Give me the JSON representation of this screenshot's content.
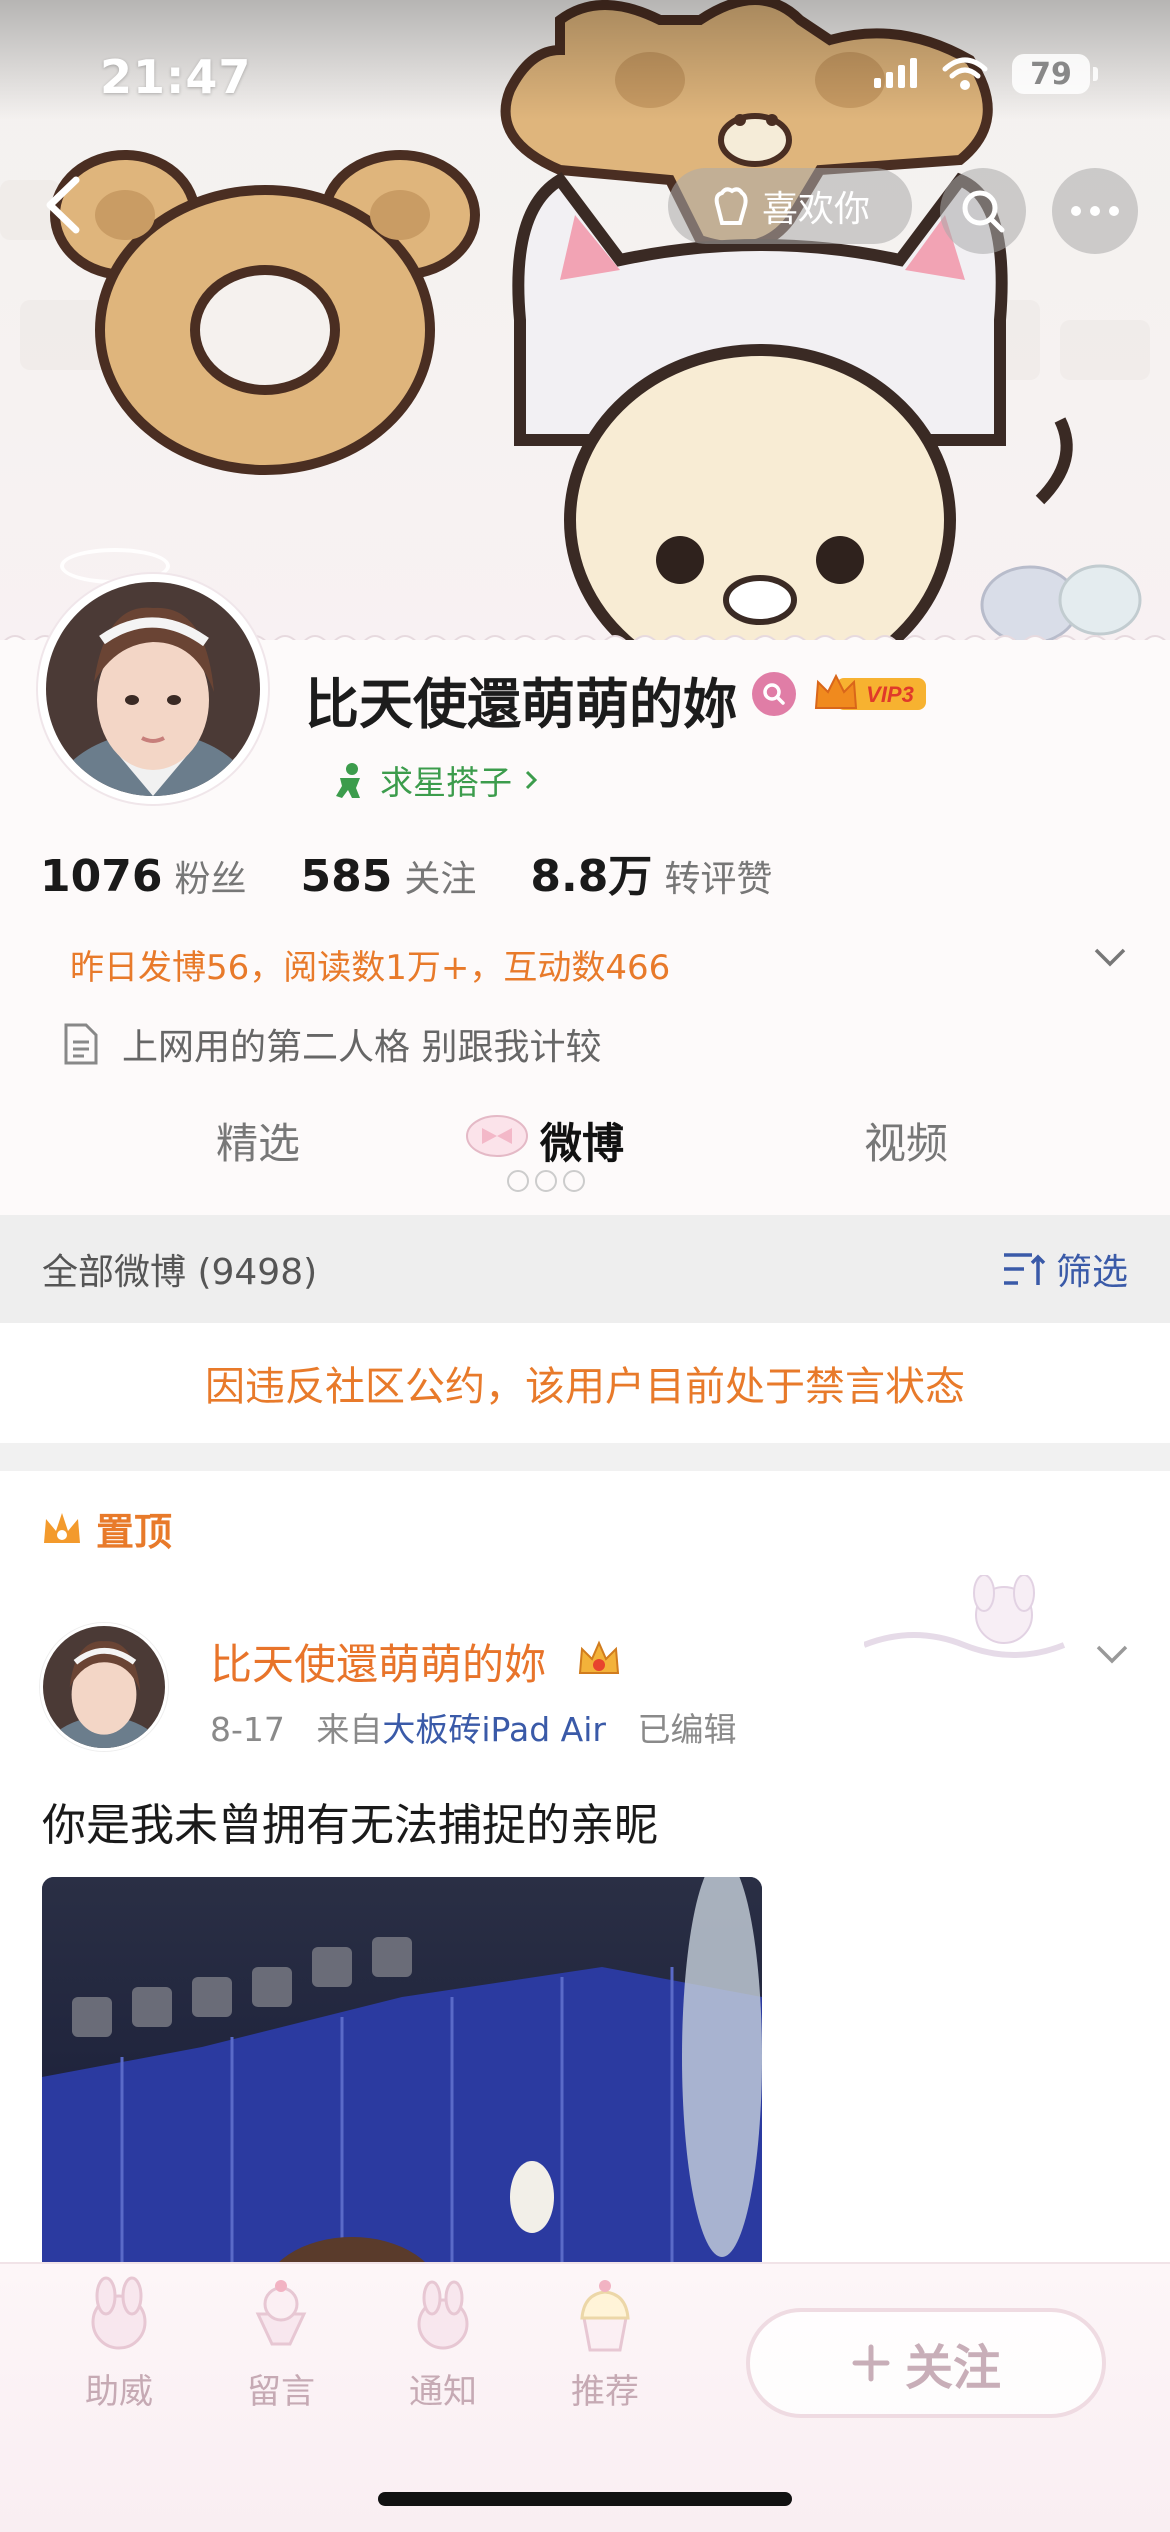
{
  "status_bar": {
    "time": "21:47",
    "battery": "79"
  },
  "nav": {
    "like_label": "喜欢你"
  },
  "profile": {
    "name": "比天使還萌萌的妳",
    "vip_label": "VIP3",
    "star_link": "求星搭子",
    "stats": [
      {
        "num": "1076",
        "label": "粉丝"
      },
      {
        "num": "585",
        "label": "关注"
      },
      {
        "num": "8.8万",
        "label": "转评赞"
      }
    ],
    "activity": "昨日发博56，阅读数1万+，互动数466",
    "bio": "上网用的第二人格 别跟我计较"
  },
  "tabs": [
    {
      "label": "精选"
    },
    {
      "label": "微博"
    },
    {
      "label": "视频"
    }
  ],
  "filter": {
    "count_label": "全部微博 (9498)",
    "filter_label": "筛选"
  },
  "ban_notice": "因违反社区公约，该用户目前处于禁言状态",
  "post": {
    "pinned_label": "置顶",
    "author": "比天使還萌萌的妳",
    "date": "8-17",
    "from_prefix": "来自",
    "device": "大板砖iPad Air",
    "edited": "已编辑",
    "text": "你是我未曾拥有无法捕捉的亲昵"
  },
  "bottom_bar": {
    "items": [
      {
        "label": "助威"
      },
      {
        "label": "留言"
      },
      {
        "label": "通知"
      },
      {
        "label": "推荐"
      }
    ],
    "follow_label": "关注"
  },
  "colors": {
    "accent_orange": "#e87a2a",
    "link_blue": "#3a5aa8",
    "star_green": "#3c9c4c",
    "pink": "#e07da6"
  }
}
